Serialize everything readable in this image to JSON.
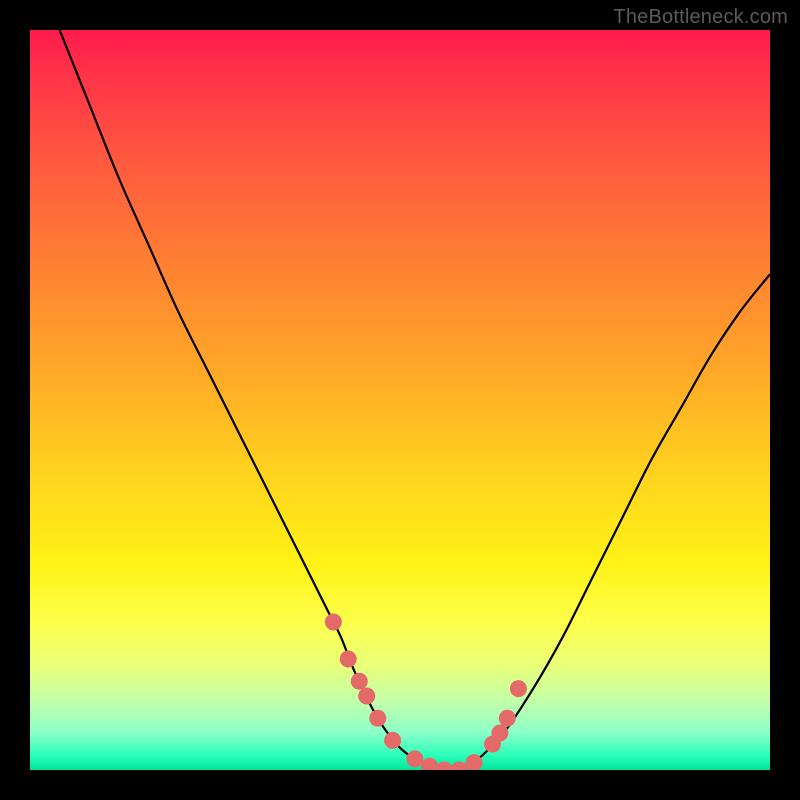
{
  "watermark": "TheBottleneck.com",
  "colors": {
    "frame_bg": "#000000",
    "gradient_top": "#ff1a4d",
    "gradient_bottom": "#00e49a",
    "curve": "#000000",
    "marker_fill": "#e46a6a",
    "marker_stroke": "#c24f4f"
  },
  "chart_data": {
    "type": "line",
    "title": "",
    "xlabel": "",
    "ylabel": "",
    "xlim": [
      0,
      100
    ],
    "ylim": [
      0,
      100
    ],
    "grid": false,
    "series": [
      {
        "name": "bottleneck-curve",
        "x": [
          4,
          8,
          12,
          16,
          20,
          24,
          28,
          32,
          36,
          40,
          42,
          44,
          47,
          50,
          53,
          56,
          58,
          60,
          64,
          68,
          72,
          76,
          80,
          84,
          88,
          92,
          96,
          100
        ],
        "values": [
          100,
          90,
          80,
          71,
          62,
          54,
          46,
          38,
          30,
          22,
          18,
          13,
          7,
          3,
          1,
          0,
          0,
          1,
          5,
          11,
          18,
          26,
          34,
          42,
          49,
          56,
          62,
          67
        ]
      }
    ],
    "markers": {
      "name": "highlight-points",
      "x": [
        41,
        43,
        44.5,
        45.5,
        47,
        49,
        52,
        54,
        56,
        58,
        60,
        62.5,
        63.5,
        64.5,
        66
      ],
      "values": [
        20,
        15,
        12,
        10,
        7,
        4,
        1.5,
        0.5,
        0,
        0,
        1,
        3.5,
        5,
        7,
        11
      ]
    }
  }
}
